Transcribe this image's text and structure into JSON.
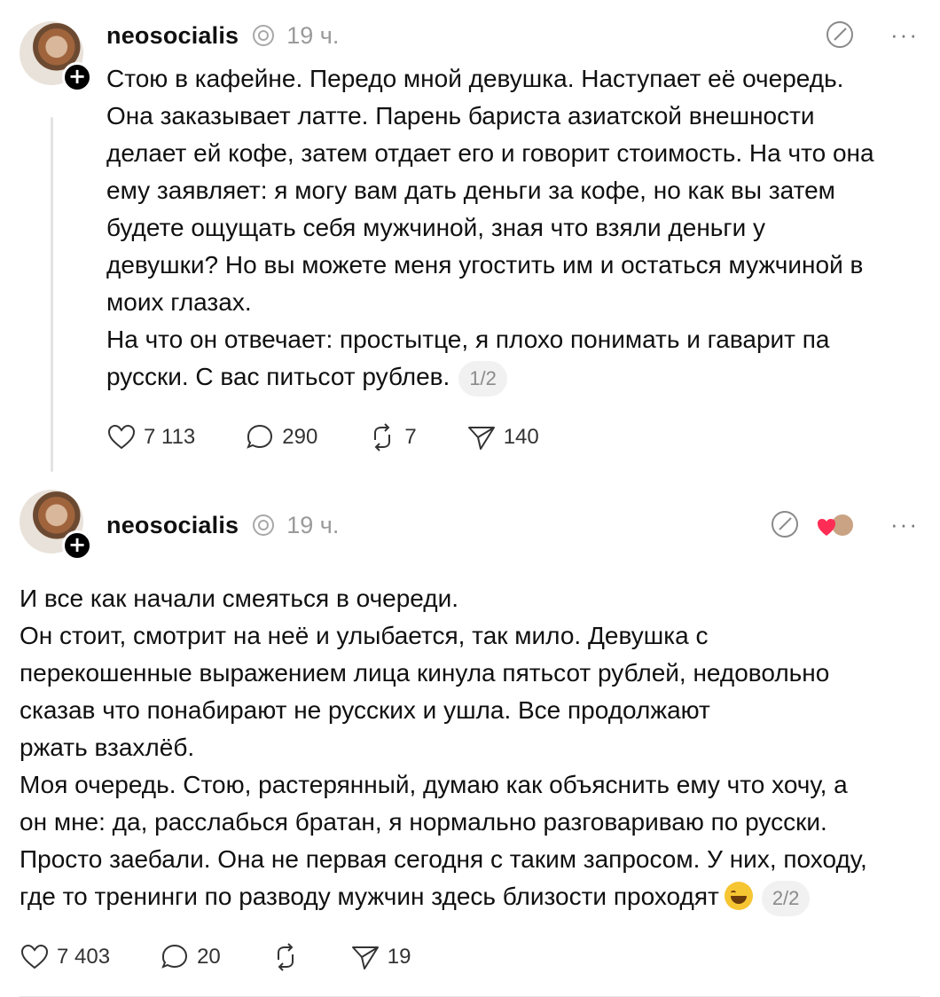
{
  "posts": [
    {
      "username": "neosocialis",
      "time": "19 ч.",
      "text": "Стою в кафейне. Передо мной девушка. Наступает её очередь.\nОна заказывает латте. Парень бариста азиатской внешности\nделает ей кофе, затем отдает его и говорит стоимость. На что она\nему заявляет: я могу вам дать деньги за кофе, но как вы затем\nбудете ощущать себя мужчиной, зная что взяли деньги у\nдевушки? Но вы можете меня угостить им и остаться мужчиной в\nмоих глазах.\nНа что он отвечает: простытце, я плохо понимать и гаварит па\nрусски. С вас питьсот рублев.",
      "page": "1/2",
      "likes": "7 113",
      "comments": "290",
      "reposts": "7",
      "shares": "140"
    },
    {
      "username": "neosocialis",
      "time": "19 ч.",
      "text": "И все как начали смеяться в очереди.\nОн стоит, смотрит на неё и улыбается, так мило. Девушка с\nперекошенные выражением лица кинула пятьсот рублей, недовольно\nсказав что понабирают не русских и ушла. Все продолжают\nржать взахлёб.\nМоя очередь. Стою, растерянный, думаю как объяснить ему что хочу, а\nон мне: да, расслабься братан, я нормально разговариваю по русски.\nПросто заебали. Она не первая сегодня с таким запросом. У них, походу,\nгде то тренинги по разводу мужчин здесь близости проходят",
      "page": "2/2",
      "likes": "7 403",
      "comments": "20",
      "shares": "19"
    }
  ],
  "icons": {
    "verified": "verified-threads-icon",
    "edit": "edit-pencil-icon",
    "more": "more-dots-icon",
    "like": "heart-icon",
    "comment": "comment-bubble-icon",
    "repost": "repost-arrows-icon",
    "share": "send-plane-icon",
    "emoji": "laughing-tears-emoji"
  },
  "more_label": "···",
  "colors": {
    "text": "#101010",
    "muted": "#9a9a9a",
    "badge_bg": "#f1f1f1",
    "like_heart": "#ff2d55"
  }
}
